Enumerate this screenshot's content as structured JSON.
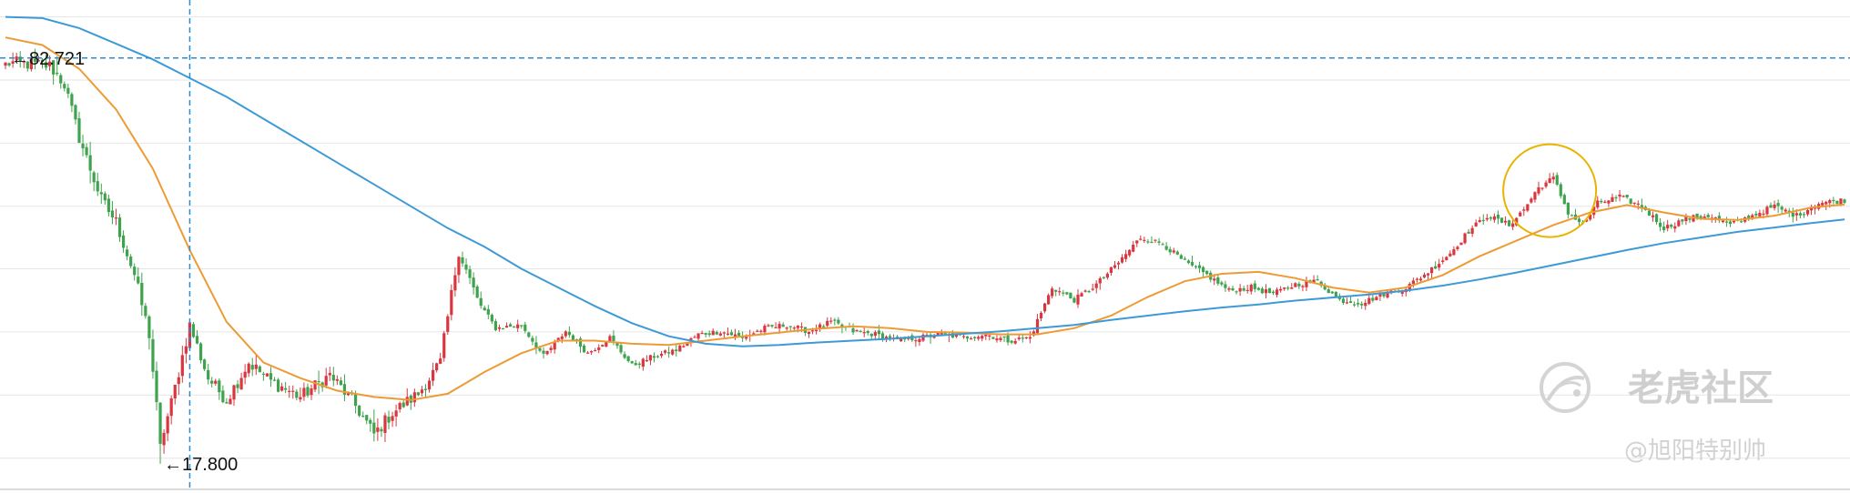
{
  "chart_data": {
    "type": "candlestick",
    "title": "",
    "xlabel": "",
    "ylabel": "",
    "ylim": [
      14,
      92
    ],
    "grid": true,
    "horizontal_gridlines": [
      89.3,
      79.2,
      69.1,
      59.0,
      49.0,
      38.9,
      28.8,
      18.7
    ],
    "crosshair": {
      "y_value": 82.721,
      "x_index": 50
    },
    "annotations": {
      "max_label": "←82.721",
      "min_label": "←17.800",
      "max_value": 82.721,
      "min_value": 17.8
    },
    "highlight": {
      "type": "circle",
      "x_index": 419,
      "y_value": 61.5,
      "color": "#e8b400"
    },
    "key_closes": [
      [
        0,
        82.0
      ],
      [
        12,
        81.5
      ],
      [
        16,
        78.5
      ],
      [
        20,
        70.0
      ],
      [
        26,
        60.0
      ],
      [
        30,
        56.5
      ],
      [
        35,
        48.0
      ],
      [
        39,
        38.5
      ],
      [
        42,
        21.0
      ],
      [
        45,
        27.5
      ],
      [
        50,
        40.0
      ],
      [
        55,
        31.5
      ],
      [
        60,
        28.0
      ],
      [
        66,
        34.0
      ],
      [
        72,
        31.0
      ],
      [
        80,
        28.5
      ],
      [
        88,
        32.0
      ],
      [
        94,
        28.0
      ],
      [
        100,
        22.5
      ],
      [
        105,
        26.0
      ],
      [
        112,
        29.0
      ],
      [
        118,
        34.0
      ],
      [
        123,
        52.0
      ],
      [
        128,
        44.0
      ],
      [
        133,
        39.5
      ],
      [
        140,
        40.0
      ],
      [
        146,
        35.0
      ],
      [
        152,
        39.0
      ],
      [
        158,
        35.5
      ],
      [
        164,
        38.0
      ],
      [
        170,
        33.5
      ],
      [
        176,
        35.0
      ],
      [
        182,
        36.0
      ],
      [
        188,
        38.5
      ],
      [
        194,
        39.0
      ],
      [
        200,
        38.0
      ],
      [
        206,
        39.5
      ],
      [
        212,
        40.0
      ],
      [
        218,
        39.0
      ],
      [
        224,
        40.5
      ],
      [
        230,
        39.0
      ],
      [
        236,
        38.5
      ],
      [
        242,
        37.5
      ],
      [
        248,
        38.0
      ],
      [
        254,
        38.5
      ],
      [
        260,
        38.0
      ],
      [
        266,
        38.5
      ],
      [
        272,
        37.5
      ],
      [
        278,
        38.0
      ],
      [
        284,
        46.0
      ],
      [
        290,
        44.0
      ],
      [
        296,
        46.5
      ],
      [
        302,
        50.0
      ],
      [
        308,
        54.0
      ],
      [
        314,
        53.0
      ],
      [
        320,
        50.0
      ],
      [
        326,
        48.0
      ],
      [
        332,
        45.5
      ],
      [
        338,
        46.0
      ],
      [
        344,
        45.0
      ],
      [
        350,
        46.5
      ],
      [
        356,
        47.0
      ],
      [
        362,
        44.0
      ],
      [
        368,
        43.5
      ],
      [
        374,
        45.0
      ],
      [
        380,
        46.0
      ],
      [
        386,
        48.5
      ],
      [
        392,
        51.5
      ],
      [
        397,
        55.0
      ],
      [
        402,
        57.5
      ],
      [
        408,
        56.0
      ],
      [
        412,
        58.5
      ],
      [
        416,
        62.0
      ],
      [
        420,
        63.5
      ],
      [
        424,
        58.0
      ],
      [
        428,
        56.0
      ],
      [
        432,
        59.5
      ],
      [
        438,
        60.5
      ],
      [
        444,
        59.0
      ],
      [
        450,
        55.5
      ],
      [
        456,
        57.0
      ],
      [
        462,
        57.5
      ],
      [
        468,
        56.0
      ],
      [
        474,
        57.5
      ],
      [
        480,
        59.0
      ],
      [
        486,
        57.5
      ],
      [
        492,
        59.5
      ],
      [
        499,
        60.0
      ]
    ],
    "series": [
      {
        "name": "",
        "type": "candles",
        "colors": {
          "up": "#d9373f",
          "down": "#3fa34d"
        }
      },
      {
        "name": "",
        "type": "line",
        "color": "#ec9b35",
        "points": [
          [
            0,
            86.0
          ],
          [
            10,
            84.8
          ],
          [
            20,
            81.0
          ],
          [
            30,
            74.5
          ],
          [
            40,
            65.0
          ],
          [
            50,
            52.0
          ],
          [
            60,
            40.5
          ],
          [
            70,
            34.0
          ],
          [
            80,
            31.5
          ],
          [
            90,
            29.5
          ],
          [
            100,
            28.5
          ],
          [
            110,
            28.0
          ],
          [
            120,
            29.0
          ],
          [
            130,
            32.5
          ],
          [
            140,
            35.5
          ],
          [
            150,
            37.5
          ],
          [
            160,
            37.5
          ],
          [
            170,
            37.0
          ],
          [
            180,
            36.8
          ],
          [
            190,
            37.5
          ],
          [
            200,
            38.2
          ],
          [
            210,
            38.8
          ],
          [
            220,
            39.4
          ],
          [
            230,
            39.8
          ],
          [
            240,
            39.5
          ],
          [
            250,
            38.9
          ],
          [
            260,
            38.8
          ],
          [
            270,
            38.5
          ],
          [
            280,
            38.5
          ],
          [
            290,
            39.5
          ],
          [
            300,
            41.5
          ],
          [
            310,
            44.5
          ],
          [
            320,
            47.0
          ],
          [
            330,
            48.2
          ],
          [
            340,
            48.5
          ],
          [
            350,
            47.5
          ],
          [
            360,
            46.0
          ],
          [
            370,
            45.2
          ],
          [
            380,
            46.0
          ],
          [
            390,
            48.0
          ],
          [
            400,
            51.0
          ],
          [
            410,
            53.5
          ],
          [
            420,
            56.0
          ],
          [
            430,
            58.0
          ],
          [
            440,
            59.2
          ],
          [
            450,
            58.0
          ],
          [
            460,
            57.0
          ],
          [
            470,
            56.8
          ],
          [
            480,
            57.5
          ],
          [
            490,
            58.8
          ],
          [
            499,
            59.3
          ]
        ]
      },
      {
        "name": "",
        "type": "line",
        "color": "#3d9ad6",
        "points": [
          [
            0,
            89.3
          ],
          [
            10,
            89.1
          ],
          [
            20,
            87.5
          ],
          [
            30,
            85.0
          ],
          [
            40,
            82.5
          ],
          [
            50,
            79.5
          ],
          [
            60,
            76.5
          ],
          [
            70,
            73.0
          ],
          [
            80,
            69.5
          ],
          [
            90,
            66.0
          ],
          [
            100,
            62.5
          ],
          [
            110,
            59.0
          ],
          [
            120,
            55.5
          ],
          [
            130,
            52.5
          ],
          [
            140,
            49.0
          ],
          [
            150,
            46.0
          ],
          [
            160,
            43.0
          ],
          [
            170,
            40.3
          ],
          [
            180,
            38.2
          ],
          [
            190,
            37.0
          ],
          [
            200,
            36.6
          ],
          [
            210,
            36.8
          ],
          [
            220,
            37.2
          ],
          [
            230,
            37.5
          ],
          [
            240,
            37.8
          ],
          [
            250,
            38.2
          ],
          [
            260,
            38.6
          ],
          [
            270,
            39.0
          ],
          [
            280,
            39.5
          ],
          [
            290,
            40.0
          ],
          [
            300,
            40.8
          ],
          [
            310,
            41.5
          ],
          [
            320,
            42.2
          ],
          [
            330,
            42.8
          ],
          [
            340,
            43.3
          ],
          [
            350,
            43.9
          ],
          [
            360,
            44.4
          ],
          [
            370,
            44.9
          ],
          [
            380,
            45.5
          ],
          [
            390,
            46.3
          ],
          [
            400,
            47.3
          ],
          [
            410,
            48.4
          ],
          [
            420,
            49.6
          ],
          [
            430,
            50.8
          ],
          [
            440,
            52.0
          ],
          [
            450,
            53.1
          ],
          [
            460,
            54.0
          ],
          [
            470,
            54.9
          ],
          [
            480,
            55.6
          ],
          [
            490,
            56.3
          ],
          [
            499,
            56.9
          ]
        ]
      }
    ]
  },
  "watermark": {
    "brand_text": "老虎社区",
    "author_text": "@旭阳特别帅",
    "logo_icon": "tiger-logo-icon",
    "color": "#cfcfcf"
  },
  "colors": {
    "gridline": "#e6e6e6",
    "crosshair": "#2b8cd6",
    "bottom_axis": "#dcdcdc"
  }
}
